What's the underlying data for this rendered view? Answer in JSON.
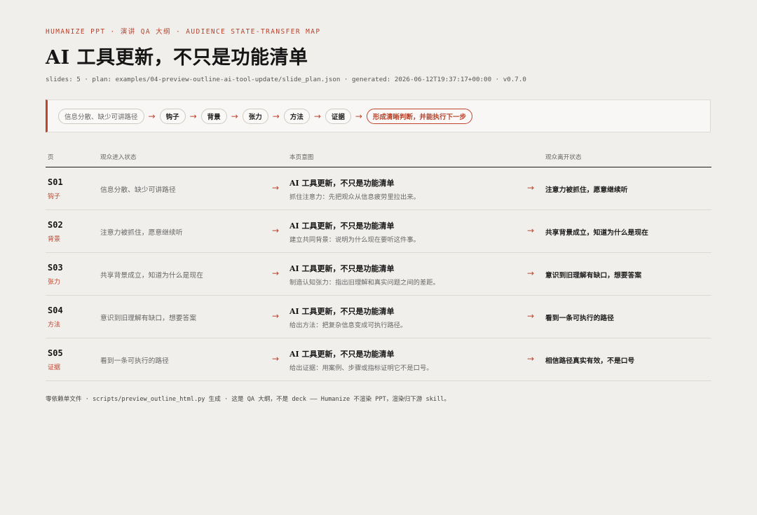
{
  "eyebrow": "HUMANIZE PPT · 演讲 QA 大纲 · AUDIENCE STATE-TRANSFER MAP",
  "title": "AI 工具更新，不只是功能清单",
  "meta": "slides: 5 · plan: examples/04-preview-outline-ai-tool-update/slide_plan.json · generated: 2026-06-12T19:37:17+00:00 · v0.7.0",
  "flow": {
    "start": "信息分散、缺少可讲路径",
    "steps": [
      "钩子",
      "背景",
      "张力",
      "方法",
      "证据"
    ],
    "end": "形成清晰判断，并能执行下一步",
    "arrow": "→"
  },
  "table": {
    "headers": {
      "page": "页",
      "enter": "观众进入状态",
      "intent": "本页意图",
      "leave": "观众离开状态"
    },
    "arrow": "→",
    "rows": [
      {
        "id": "S01",
        "tag": "钩子",
        "enter": "信息分散、缺少可讲路径",
        "intent_title": "AI 工具更新，不只是功能清单",
        "intent_desc": "抓住注意力：先把观众从信息疲劳里拉出来。",
        "leave": "注意力被抓住，愿意继续听"
      },
      {
        "id": "S02",
        "tag": "背景",
        "enter": "注意力被抓住，愿意继续听",
        "intent_title": "AI 工具更新，不只是功能清单",
        "intent_desc": "建立共同背景：说明为什么现在要听这件事。",
        "leave": "共享背景成立，知道为什么是现在"
      },
      {
        "id": "S03",
        "tag": "张力",
        "enter": "共享背景成立，知道为什么是现在",
        "intent_title": "AI 工具更新，不只是功能清单",
        "intent_desc": "制造认知张力：指出旧理解和真实问题之间的差距。",
        "leave": "意识到旧理解有缺口，想要答案"
      },
      {
        "id": "S04",
        "tag": "方法",
        "enter": "意识到旧理解有缺口，想要答案",
        "intent_title": "AI 工具更新，不只是功能清单",
        "intent_desc": "给出方法：把复杂信息变成可执行路径。",
        "leave": "看到一条可执行的路径"
      },
      {
        "id": "S05",
        "tag": "证据",
        "enter": "看到一条可执行的路径",
        "intent_title": "AI 工具更新，不只是功能清单",
        "intent_desc": "给出证据：用案例、步骤或指标证明它不是口号。",
        "leave": "相信路径真实有效，不是口号"
      }
    ]
  },
  "footer": "零依赖单文件 · scripts/preview_outline_html.py 生成 · 这是 QA 大纲，不是 deck —— Humanize 不渲染 PPT，渲染归下游 skill。"
}
